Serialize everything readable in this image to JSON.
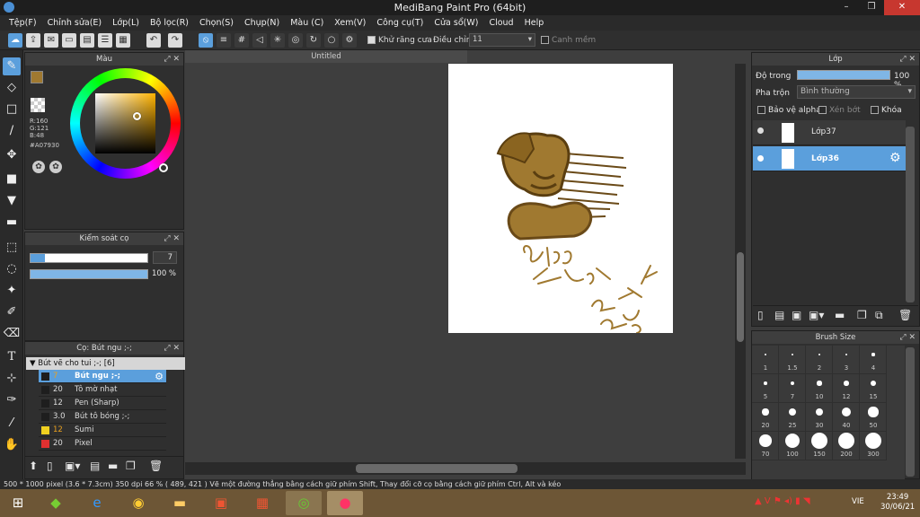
{
  "window": {
    "title": "MediBang Paint Pro (64bit)",
    "minimize": "–",
    "restore": "❒",
    "close": "✕"
  },
  "menu": [
    "Tệp(F)",
    "Chỉnh sửa(E)",
    "Lớp(L)",
    "Bộ lọc(R)",
    "Chọn(S)",
    "Chụp(N)",
    "Màu (C)",
    "Xem(V)",
    "Công cụ(T)",
    "Cửa sổ(W)",
    "Cloud",
    "Help"
  ],
  "toolbar": {
    "antialias_label": "Khử răng cưa",
    "adjust_label": "Điều chỉnh",
    "adjust_value": "11",
    "edge_label": "Canh mềm"
  },
  "color_panel": {
    "title": "Màu",
    "r": "R:160",
    "g": "G:121",
    "b": "B:48",
    "hex": "#A07930",
    "main_color": "#A07930"
  },
  "brush_control": {
    "title": "Kiểm soát cọ",
    "size": "7",
    "opacity": "100 %",
    "size_fraction": 0.12,
    "opacity_fraction": 1.0
  },
  "brush_panel": {
    "title": "Cọ: Bút ngu ;-;",
    "group": "Bút vẽ cho tui ;-; [6]",
    "items": [
      {
        "size": "7",
        "name": "Bút ngu ;-;",
        "color": "#1e1e1e",
        "selected": true
      },
      {
        "size": "20",
        "name": "Tô mờ nhạt",
        "color": "#1e1e1e",
        "selected": false
      },
      {
        "size": "12",
        "name": "Pen (Sharp)",
        "color": "#1e1e1e",
        "selected": false
      },
      {
        "size": "3.0",
        "name": "Bút tô bóng ;-;",
        "color": "#1e1e1e",
        "selected": false
      },
      {
        "size": "12",
        "name": "Sumi",
        "color": "#f0d020",
        "selected": false
      },
      {
        "size": "20",
        "name": "Pixel",
        "color": "#e03030",
        "selected": false
      }
    ]
  },
  "canvas": {
    "tab": "Untitled"
  },
  "layer_panel": {
    "title": "Lớp",
    "opacity_label": "Độ trong",
    "opacity_value": "100 %",
    "blend_label": "Pha trộn",
    "blend_value": "Bình thường",
    "protect_alpha": "Bảo vệ alpha",
    "clipping": "Xén bớt",
    "lock": "Khóa",
    "layers": [
      {
        "name": "Lớp37",
        "selected": false
      },
      {
        "name": "Lớp36",
        "selected": true
      }
    ]
  },
  "brush_size_panel": {
    "title": "Brush Size",
    "sizes": [
      "1",
      "1.5",
      "2",
      "3",
      "4",
      "5",
      "7",
      "10",
      "12",
      "15",
      "20",
      "25",
      "30",
      "40",
      "50",
      "70",
      "100",
      "150",
      "200",
      "300"
    ]
  },
  "statusbar": {
    "text": "500 * 1000 pixel   (3.6 * 7.3cm)   350 dpi   66 %   ( 489, 421 )   Vẽ một đường thẳng bằng cách giữ phím Shift, Thay đổi cỡ cọ bằng cách giữ phím Ctrl, Alt và kéo"
  },
  "taskbar": {
    "lang": "VIE",
    "time": "23:49",
    "date": "30/06/21"
  }
}
